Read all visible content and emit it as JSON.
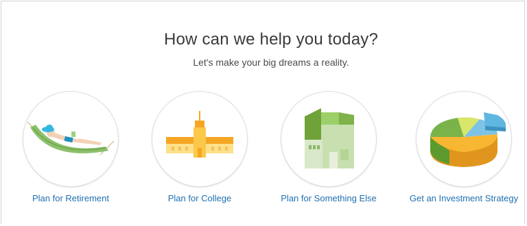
{
  "heading": "How can we help you today?",
  "subheading": "Let's make your big dreams a reality.",
  "cards": [
    {
      "label": "Plan for Retirement",
      "icon": "hammock-icon"
    },
    {
      "label": "Plan for College",
      "icon": "college-building-icon"
    },
    {
      "label": "Plan for Something Else",
      "icon": "house-icon"
    },
    {
      "label": "Get an Investment Strategy",
      "icon": "pie-chart-icon"
    }
  ],
  "colors": {
    "link": "#1f6fb2",
    "heading": "#3a3a3a",
    "border": "#dedede"
  }
}
